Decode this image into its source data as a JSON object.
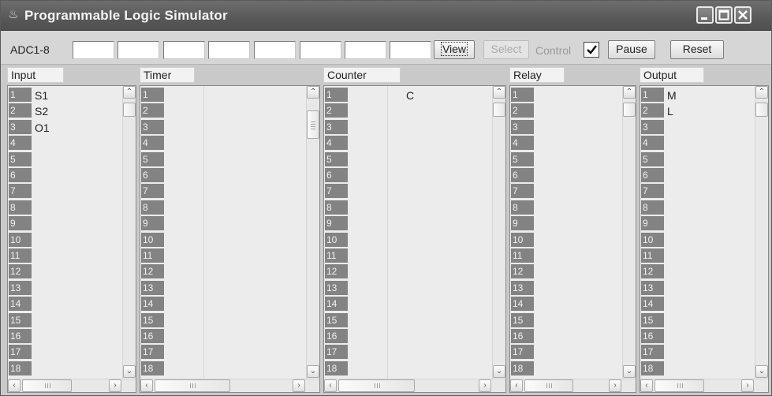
{
  "window": {
    "title": "Programmable Logic Simulator",
    "app_icon": "java-cup-icon",
    "controls": [
      "minimize-icon",
      "maximize-icon",
      "close-icon"
    ]
  },
  "toolbar": {
    "adc_label": "ADC1-8",
    "adc_fields": [
      "",
      "",
      "",
      "",
      "",
      "",
      "",
      ""
    ],
    "view_label": "View",
    "select_label": "Select",
    "control_label": "Control",
    "control_checked": true,
    "pause_label": "Pause",
    "reset_label": "Reset"
  },
  "panels": [
    {
      "header": "Input",
      "values": [
        "S1",
        "S2",
        "O1"
      ],
      "value_column": "left"
    },
    {
      "header": "Timer",
      "values": [],
      "value_column": "left"
    },
    {
      "header": "Counter",
      "values": [
        "C"
      ],
      "value_column": "right"
    },
    {
      "header": "Relay",
      "values": [],
      "value_column": "left"
    },
    {
      "header": "Output",
      "values": [
        "M",
        "L"
      ],
      "value_column": "left"
    }
  ],
  "row_numbers": [
    "1",
    "2",
    "3",
    "4",
    "5",
    "6",
    "7",
    "8",
    "9",
    "10",
    "11",
    "12",
    "13",
    "14",
    "15",
    "16",
    "17",
    "18"
  ],
  "colors": {
    "titlebar": "#5a5a5a",
    "row_number_bg": "#838383",
    "panel_bg": "#ececec"
  }
}
